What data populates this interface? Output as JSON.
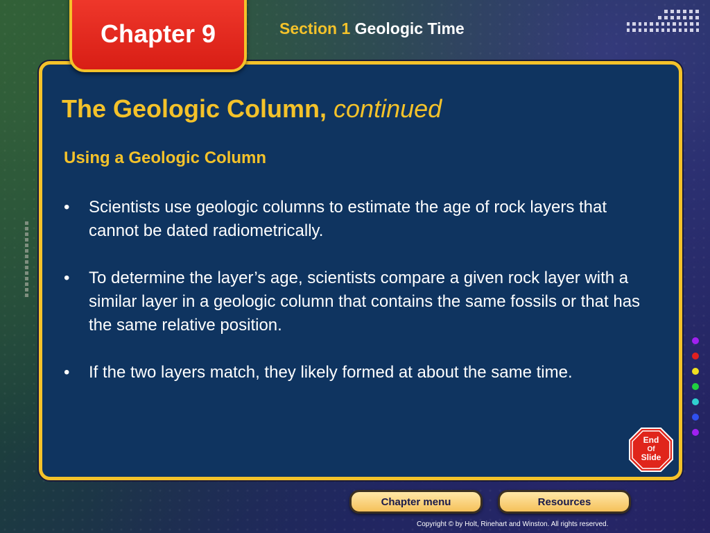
{
  "header": {
    "chapter_label": "Chapter 9",
    "section_label": "Section 1",
    "section_title": "Geologic Time"
  },
  "slide": {
    "title_main": "The Geologic Column,",
    "title_suffix": "continued",
    "subheading": "Using a Geologic Column",
    "bullets": [
      "Scientists use geologic columns to estimate the age of rock layers that cannot be dated radiometrically.",
      "To determine the layer’s age, scientists compare a given rock layer with a similar layer in a geologic column that contains the same fossils or that has the same relative position.",
      "If the two layers match, they likely formed at about the same time."
    ]
  },
  "end_slide_icon": {
    "text_line1": "End",
    "text_line2": "Of",
    "text_line3": "Slide"
  },
  "footer": {
    "chapter_menu_label": "Chapter menu",
    "resources_label": "Resources",
    "copyright": "Copyright © by Holt, Rinehart and Winston. All rights reserved."
  },
  "colors": {
    "accent_yellow": "#f4c22a",
    "panel_blue": "#0f3460",
    "tab_red": "#e0251b",
    "indicator_dots": [
      "#a020f0",
      "#e02020",
      "#f0e020",
      "#20d040",
      "#30d0d0",
      "#3050f0",
      "#a020f0"
    ]
  }
}
